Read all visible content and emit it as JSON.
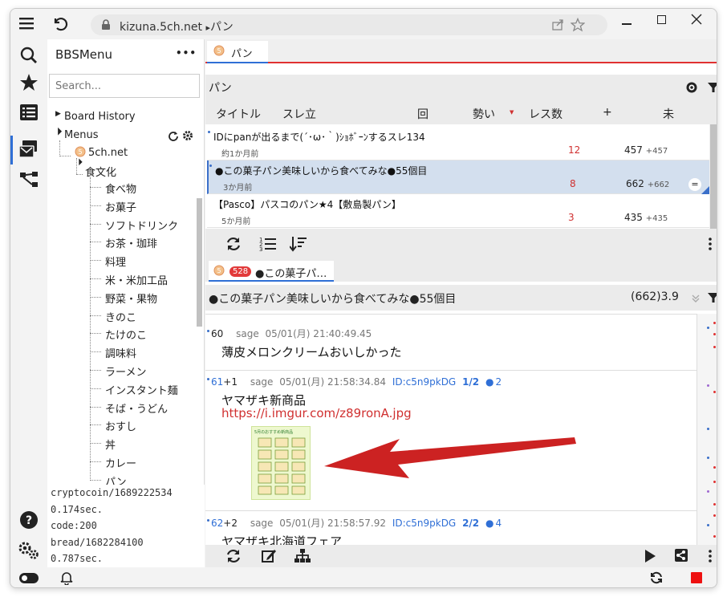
{
  "titlebar": {
    "url_host": "kizuna.5ch.net",
    "url_sep": "▸",
    "url_path": "パン"
  },
  "sidebar": {
    "title": "BBSMenu",
    "menu_dots": "•••",
    "search_placeholder": "Search...",
    "board_history": "Board History",
    "menus": "Menus",
    "site": "5ch.net",
    "category": "食文化",
    "boards": [
      "食べ物",
      "お菓子",
      "ソフトドリンク",
      "お茶・珈琲",
      "料理",
      "米・米加工品",
      "野菜・果物",
      "きのこ",
      "たけのこ",
      "調味料",
      "ラーメン",
      "インスタント麺",
      "そば・うどん",
      "おすし",
      "丼",
      "カレー",
      "パン"
    ]
  },
  "log": {
    "lines": [
      "cryptocoin/1689222534",
      "0.174sec.",
      "code:200",
      "bread/1682284100",
      "0.787sec."
    ]
  },
  "board_tab": {
    "label": "パン"
  },
  "board_header": {
    "title": "パン"
  },
  "columns": {
    "title": "タイトル",
    "thread": "スレ立",
    "count": "回",
    "momentum": "勢い",
    "res": "レス数",
    "plus": "+",
    "unread": "未"
  },
  "threads": [
    {
      "title": "IDにpanが出るまで(´･ω･｀)ｼｮﾎﾞｰﾝするスレ134",
      "age": "約1か月前",
      "count": "12",
      "res": "457",
      "res_new": "+457"
    },
    {
      "title": "●この菓子パン美味しいから食べてみな●55個目",
      "age": "3か月前",
      "count": "8",
      "res": "662",
      "res_new": "+662"
    },
    {
      "title": "【Pasco】パスコのパン★4【敷島製パン】",
      "age": "5か月前",
      "count": "3",
      "res": "435",
      "res_new": "+435"
    }
  ],
  "thread_tab": {
    "badge": "528",
    "label": "●この菓子パ…"
  },
  "thread_header": {
    "title": "●この菓子パン美味しいから食べてみな●55個目",
    "stats": "(662)3.9"
  },
  "posts": [
    {
      "num": "60",
      "sage": "sage",
      "date": "05/01(月) 21:40:49.45",
      "id": "",
      "idcount": "",
      "replies": "",
      "body": "薄皮メロンクリームおいしかった",
      "link": ""
    },
    {
      "num": "61",
      "plus": "+1",
      "sage": "sage",
      "date": "05/01(月) 21:58:34.84",
      "id": "ID:c5n9pkDG",
      "idcount": "1/2",
      "replies": "2",
      "body": "ヤマザキ新商品",
      "link": "https://i.imgur.com/z89ronA.jpg"
    },
    {
      "num": "62",
      "plus": "+2",
      "sage": "sage",
      "date": "05/01(月) 21:58:57.92",
      "id": "ID:c5n9pkDG",
      "idcount": "2/2",
      "replies": "4",
      "body": "ヤマザキ北海道フェア",
      "link": ""
    }
  ],
  "thumbnail": {
    "caption": "5月のおすすめ新商品"
  },
  "colors": {
    "accent": "#2f6fd6",
    "red": "#e03030",
    "arrow": "#cc2222"
  }
}
